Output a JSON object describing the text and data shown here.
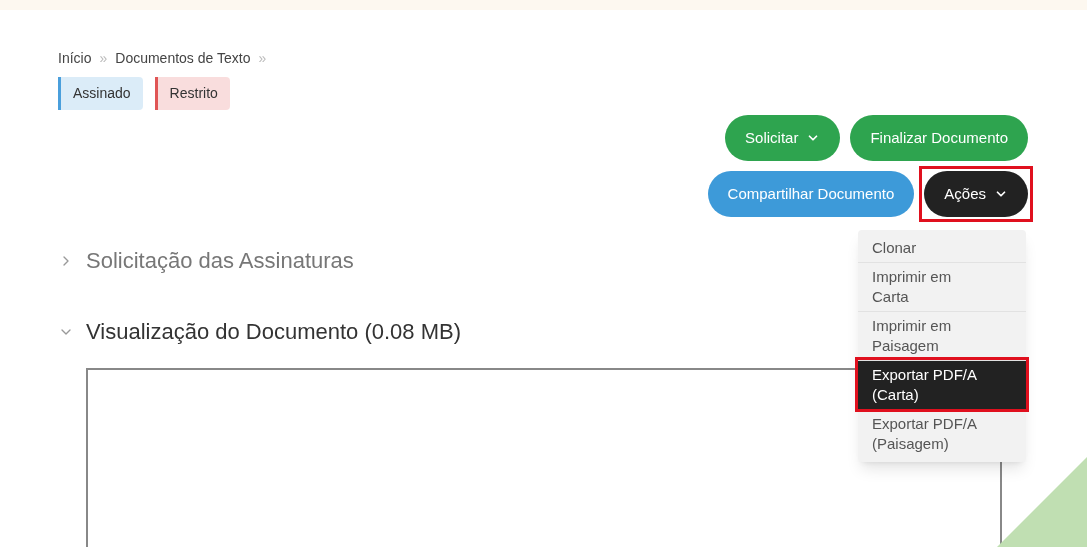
{
  "breadcrumb": [
    {
      "label": "Início",
      "separator": "»"
    },
    {
      "label": "Documentos de Texto",
      "separator": "»"
    }
  ],
  "tags": [
    {
      "label": "Assinado",
      "color": "#4a9fdc"
    },
    {
      "label": "Restrito",
      "color": "#e05555"
    }
  ],
  "buttons": [
    {
      "label": "Solicitar",
      "kind": "green",
      "dropdown": true,
      "highlighted": false
    },
    {
      "label": "Finalizar Documento",
      "kind": "green",
      "dropdown": false,
      "highlighted": false
    },
    {
      "label": "Compartilhar Documento",
      "kind": "blue",
      "dropdown": false,
      "highlighted": false
    },
    {
      "label": "Ações",
      "kind": "dark",
      "dropdown": true,
      "highlighted": true
    }
  ],
  "menu": [
    {
      "label": "Clonar",
      "selected": false
    },
    {
      "label": "Imprimir em Carta",
      "selected": false
    },
    {
      "label": "Imprimir em Paisagem",
      "selected": false
    },
    {
      "label": "Exportar PDF/A (Carta)",
      "selected": true
    },
    {
      "label": "Exportar PDF/A (Paisagem)",
      "selected": false
    }
  ],
  "sections": [
    {
      "title": "Solicitação das Assinaturas",
      "expanded": false
    },
    {
      "title": "Visualização do Documento (0.08 MB)",
      "expanded": true
    }
  ]
}
